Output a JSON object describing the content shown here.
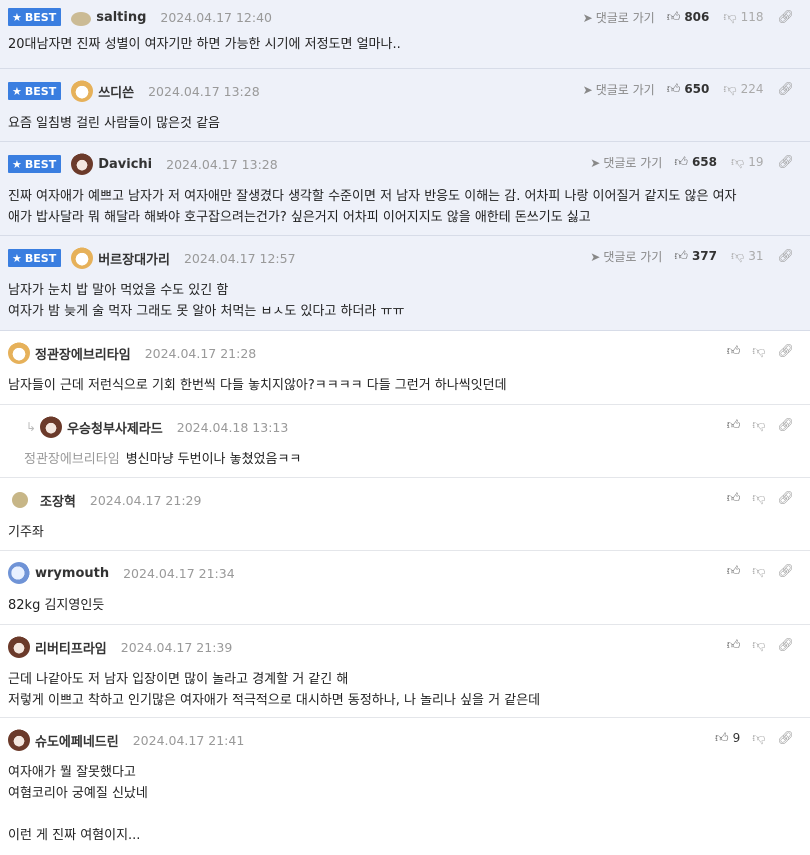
{
  "best_label": "BEST",
  "reply_label": "댓글로 가기",
  "comments": [
    {
      "nick": "salting",
      "date": "2024.04.17 12:40",
      "up": "806",
      "down": "118",
      "lines": [
        "20대남자면 진짜 성별이 여자기만 하면 가능한 시기에 저정도면 얼마나.."
      ],
      "avatar": "beige-blob-icon"
    },
    {
      "nick": "쓰디쓴",
      "date": "2024.04.17 13:28",
      "up": "650",
      "down": "224",
      "lines": [
        "요즘 일침병 걸린 사람들이 많은것 같음"
      ],
      "avatar": "dog-avatar-icon"
    },
    {
      "nick": "Davichi",
      "date": "2024.04.17 13:28",
      "up": "658",
      "down": "19",
      "lines": [
        "진짜 여자애가 예쁘고 남자가 저 여자애만 잘생겼다 생각할 수준이면 저 남자 반응도 이해는 감. 어차피 나랑 이어질거 같지도 않은 여자",
        "애가 밥사달라 뭐 해달라 해봐야 호구잡으려는건가? 싶은거지 어차피 이어지지도 않을 애한테 돈쓰기도 싫고"
      ],
      "avatar": "bear-avatar-icon"
    },
    {
      "nick": "버르장대가리",
      "date": "2024.04.17 12:57",
      "up": "377",
      "down": "31",
      "lines": [
        "남자가 눈치 밥 말아 먹었을 수도 있긴 함",
        "여자가 밤 늦게 술 먹자 그래도 못 알아 처먹는 ㅂㅅ도 있다고 하더라 ㅠㅠ"
      ],
      "avatar": "dog-avatar-icon"
    },
    {
      "nick": "정관장에브리타임",
      "date": "2024.04.17 21:28",
      "lines": [
        "남자들이 근데 저런식으로 기회 한번씩 다들 놓치지않아?ㅋㅋㅋㅋ 다들 그런거 하나씩잇던데"
      ],
      "avatar": "dog-avatar-icon"
    },
    {
      "nick": "우승청부사제라드",
      "date": "2024.04.18 13:13",
      "mention": "정관장에브리타임",
      "lines": [
        "병신마냥 두번이나 놓쳤었음ㅋㅋ"
      ],
      "avatar": "bear-avatar-icon"
    },
    {
      "nick": "조장혁",
      "date": "2024.04.17 21:29",
      "lines": [
        "기주좌"
      ],
      "avatar": "beige-dot-icon"
    },
    {
      "nick": "wrymouth",
      "date": "2024.04.17 21:34",
      "lines": [
        "82kg 김지영인듯"
      ],
      "avatar": "seal-avatar-icon"
    },
    {
      "nick": "리버티프라임",
      "date": "2024.04.17 21:39",
      "lines": [
        "근데 나같아도 저 남자 입장이면 많이 놀라고 경계할 거 같긴 해",
        "저렇게 이쁘고 착하고 인기많은 여자애가 적극적으로 대시하면 동정하나, 나 놀리나 싶을 거 같은데"
      ],
      "avatar": "bear-avatar-icon"
    },
    {
      "nick": "슈도에페네드린",
      "date": "2024.04.17 21:41",
      "up": "9",
      "lines": [
        "여자애가 뭘 잘못했다고",
        "여혐코리아 궁예질 신났네",
        "",
        "이런 게 진짜 여혐이지..."
      ],
      "avatar": "bear-avatar-icon"
    }
  ]
}
